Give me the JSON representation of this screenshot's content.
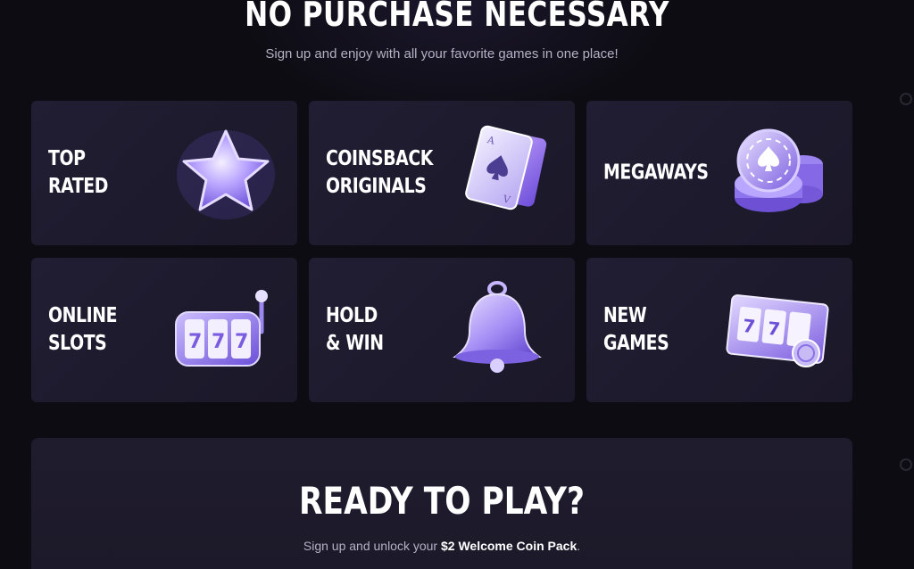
{
  "hero": {
    "title": "NO PURCHASE NECESSARY",
    "subtitle": "Sign up and enjoy with all your favorite games in one place!"
  },
  "categories": [
    {
      "label": "TOP\nRATED",
      "icon": "star-icon"
    },
    {
      "label": "COINSBACK\nORIGINALS",
      "icon": "playing-card-icon"
    },
    {
      "label": "MEGAWAYS",
      "icon": "coin-stack-icon"
    },
    {
      "label": "ONLINE\nSLOTS",
      "icon": "slot-machine-icon"
    },
    {
      "label": "HOLD\n& WIN",
      "icon": "bell-icon"
    },
    {
      "label": "NEW GAMES",
      "icon": "slot-ticket-icon"
    }
  ],
  "cta": {
    "title": "READY TO PLAY?",
    "subtitle_prefix": "Sign up and unlock your ",
    "subtitle_bold": "$2 Welcome Coin Pack",
    "subtitle_suffix": "."
  },
  "colors": {
    "background": "#0d0c12",
    "card": "#211d33",
    "accent": "#a58cff"
  }
}
